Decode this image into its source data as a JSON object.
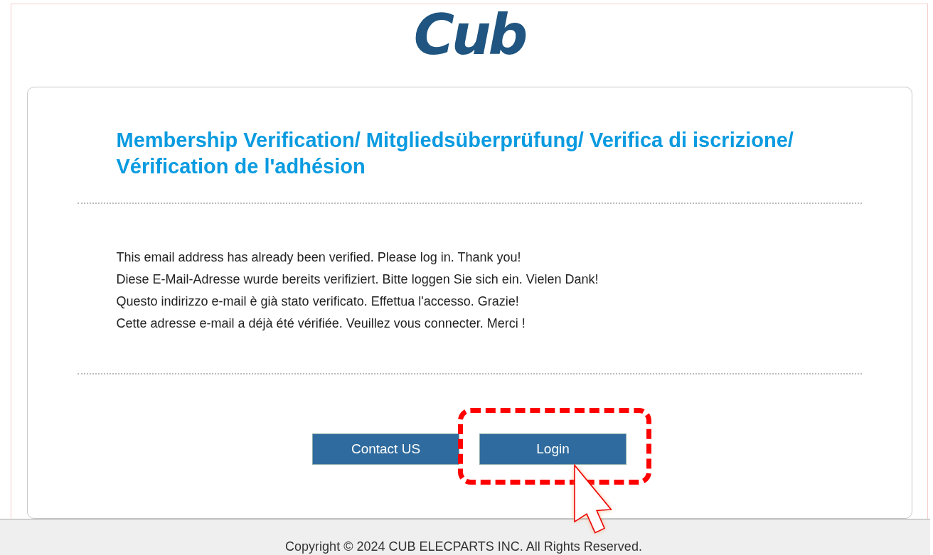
{
  "logo": {
    "text": "Cub"
  },
  "title": "Membership Verification/ Mitgliedsüberprüfung/ Verifica di iscrizione/ Vérification de l'adhésion",
  "messages": [
    "This email address has already been verified. Please log in. Thank you!",
    "Diese E-Mail-Adresse wurde bereits verifiziert. Bitte loggen Sie sich ein. Vielen Dank!",
    "Questo indirizzo e-mail è già stato verificato. Effettua l'accesso. Grazie!",
    "Cette adresse e-mail a déjà été vérifiée. Veuillez vous connecter. Merci !"
  ],
  "buttons": [
    {
      "label": "Contact US",
      "highlighted": false
    },
    {
      "label": "Login",
      "highlighted": true
    }
  ],
  "footer": "Copyright © 2024 CUB ELECPARTS INC. All Rights Reserved."
}
